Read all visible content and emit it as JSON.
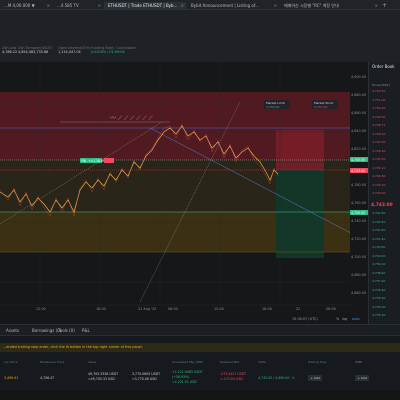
{
  "tabs": [
    {
      "label": "...M 4,00.000 ▼"
    },
    {
      "label": "...4.585 TV"
    },
    {
      "label": "ETHUSDT | Trade ETHUSDT | Byb..."
    },
    {
      "label": "Bybit Announcement | Listing of..."
    },
    {
      "label": "매매하신 시장별 \"RC\" 계정 안내"
    }
  ],
  "topbar": {
    "stats": [
      {
        "label": "24h Low",
        "value": "4,786.22"
      },
      {
        "label": "24h Turnover(USDT)",
        "value": "4,854,483,735.86"
      },
      {
        "label": "Open Interest(ETH)",
        "value": "1,114,447.04"
      },
      {
        "label": "Funding Rate / Countdown",
        "value": "0.0100% / 01:59:04"
      }
    ],
    "chart_modes": [
      "Standard",
      "TradingView",
      "Depth"
    ]
  },
  "chart": {
    "take_profit_label": "Market Limit",
    "take_profit_value": "4,743.00",
    "stop_loss_label": "Market Short",
    "stop_loss_value": "4,743.00",
    "axis_labels": [
      "4,900.00",
      "4,880.00",
      "4,860.00",
      "4,840.00",
      "4,820.00",
      "4,800.00",
      "4,780.00",
      "4,760.00",
      "4,740.00",
      "4,720.00",
      "4,700.00",
      "4,680.00",
      "4,660.00"
    ],
    "price_tag_entry": "4,745.00",
    "price_tag_current": "4,743.00",
    "price_tag_low": "4,700.00",
    "entry_tag_text": "PNL +4,138.89",
    "date_label": "21 Aug '25",
    "time_labels": [
      "12:00",
      "18:00",
      "21 Aug '25",
      "06:00",
      "12:00",
      "18:00",
      "22",
      "06:00"
    ],
    "clock": "15:35:07 (UTC)",
    "scale_options": [
      "%",
      "log",
      "auto"
    ],
    "pattern_label": "〰 ⟋ ⟋ ⟋ ⟋ ⟋ ⟋"
  },
  "orderbook": {
    "title": "Order Book",
    "sub": "Price(USDT)",
    "asks": [
      "4,752.50",
      "4,751.00",
      "4,750.80",
      "4,749.90",
      "4,748.71",
      "4,748.20",
      "4,747.00",
      "4,746.40",
      "4,745.50",
      "4,745.10",
      "4,744.80",
      "4,744.20",
      "4,743.90"
    ],
    "mid": "4,743.00",
    "bids": [
      "4,742.80",
      "4,742.40",
      "4,741.90",
      "4,741.20",
      "4,740.80",
      "4,740.00",
      "4,739.10",
      "4,738.60",
      "4,737.90",
      "4,736.40",
      "4,735.20",
      "4,734.00",
      "4,733.30"
    ]
  },
  "panel_tabs": [
    "Assets",
    "Borrowings (0)",
    "Tools (0)",
    "P&L"
  ],
  "warning": "...ended trailing stop order, click the ⚙ button in the top right corner of this panel.",
  "positions": {
    "headers": [
      "Liq. Price",
      "Breakeven Price",
      "Value",
      "Unrealized P&L (ROI)",
      "Realized P&L",
      "TP/SL",
      "Trailing Stop",
      "MMR"
    ],
    "row": {
      "liq_price": "3,499.91",
      "breakeven_price": "4,706.47",
      "value": "49,705.3338 USDT",
      "value_sub": "≈49,705.33 USD",
      "margin": "3,770.0605 USDT",
      "margin_sub": "≈3,770.06 USD",
      "unrealized": "+2,221.9083 USDT",
      "unrealized_sub": "(+58.93%)",
      "unrealized_sub2": "≈2,221.91 USD",
      "realized": "-273.0427 USDT",
      "realized_sub": "≈-273.04 USD",
      "tpsl": "4,745.00 / 4,690.00",
      "tpsl_btn": "✎",
      "add_label": "+ Add",
      "add_label2": "+ Add"
    }
  },
  "colors": {
    "up": "#2ebd85",
    "down": "#f6465d",
    "accent": "#f0b90b",
    "bg": "#151719"
  }
}
